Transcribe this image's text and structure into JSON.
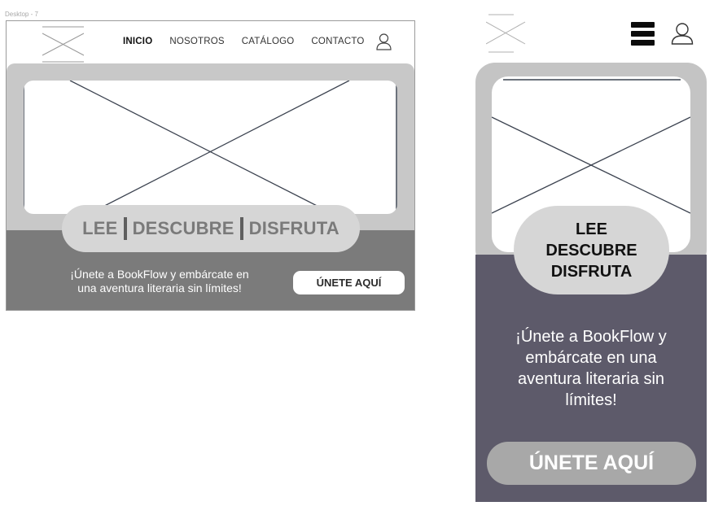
{
  "frame_label": "Desktop - 7",
  "nav": {
    "items": [
      {
        "label": "INICIO",
        "active": true
      },
      {
        "label": "NOSOTROS",
        "active": false
      },
      {
        "label": "CATÁLOGO",
        "active": false
      },
      {
        "label": "CONTACTO",
        "active": false
      }
    ]
  },
  "hero": {
    "tagline_words": [
      "LEE",
      "DESCUBRE",
      "DISFRUTA"
    ],
    "join_text": "¡Únete a BookFlow y embárcate en una aventura literaria sin límites!",
    "desktop_join_lines": [
      "¡Únete a BookFlow y embárcate en",
      "una aventura literaria sin límites!"
    ],
    "mobile_join_lines": [
      "¡Únete a BookFlow y",
      "embárcate en una",
      "aventura literaria sin",
      "límites!"
    ],
    "cta_label": "ÚNETE AQUÍ"
  },
  "icons": {
    "logo": "image-placeholder-icon",
    "user": "user-icon",
    "menu": "hamburger-menu-icon"
  },
  "colors": {
    "desktop_hero_bg": "#c8c8c8",
    "desktop_bottom_bg": "#7b7b7b",
    "mobile_bottom_bg": "#5d5a6a",
    "pill_bg": "#d6d6d6"
  }
}
